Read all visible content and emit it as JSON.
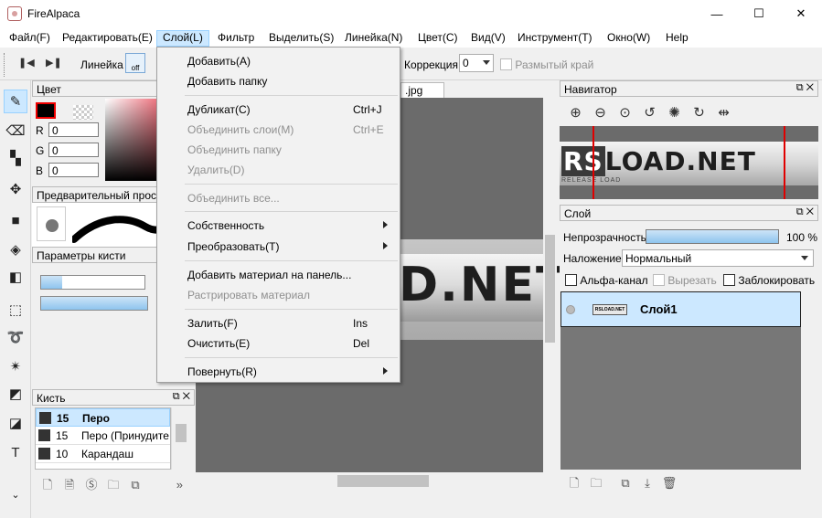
{
  "titlebar": {
    "title": "FireAlpaca",
    "minimize": "—",
    "maximize": "☐",
    "close": "✕"
  },
  "menubar": {
    "items": [
      "Файл(F)",
      "Редактировать(E)",
      "Слой(L)",
      "Фильтр",
      "Выделить(S)",
      "Линейка(N)",
      "Цвет(C)",
      "Вид(V)",
      "Инструмент(T)",
      "Окно(W)",
      "Help"
    ],
    "active": "Слой(L)"
  },
  "toolbar": {
    "ruler_label": "Линейка",
    "toggle_label": "off",
    "correction_label": "Коррекция",
    "correction_value": "0",
    "blur_edge_label": "Размытый край"
  },
  "dropdown": {
    "items": [
      {
        "label": "Добавить(A)",
        "enabled": true
      },
      {
        "label": "Добавить папку",
        "enabled": true
      },
      {
        "label": "Дубликат(C)",
        "shortcut": "Ctrl+J",
        "enabled": true
      },
      {
        "label": "Объединить слои(M)",
        "shortcut": "Ctrl+E",
        "enabled": false
      },
      {
        "label": "Объединить папку",
        "enabled": false
      },
      {
        "label": "Удалить(D)",
        "enabled": false
      },
      {
        "label": "Объединить все...",
        "enabled": false
      },
      {
        "label": "Собственность",
        "submenu": true,
        "enabled": true
      },
      {
        "label": "Преобразовать(T)",
        "submenu": true,
        "enabled": true
      },
      {
        "label": "Добавить материал на панель...",
        "enabled": true
      },
      {
        "label": "Растрировать материал",
        "enabled": false
      },
      {
        "label": "Залить(F)",
        "shortcut": "Ins",
        "enabled": true
      },
      {
        "label": "Очистить(E)",
        "shortcut": "Del",
        "enabled": true
      },
      {
        "label": "Повернуть(R)",
        "submenu": true,
        "enabled": true
      }
    ]
  },
  "color_panel": {
    "title": "Цвет",
    "r_label": "R",
    "g_label": "G",
    "b_label": "B",
    "r": "0",
    "g": "0",
    "b": "0",
    "fg_color": "#000000"
  },
  "preview_panel": {
    "title": "Предварительный прос..."
  },
  "brush_params": {
    "title": "Параметры кисти",
    "size_level": 0.2,
    "opacity_level": 1.0
  },
  "brush_panel": {
    "title": "Кисть",
    "items": [
      {
        "size": "15",
        "name": "Перо",
        "selected": true
      },
      {
        "size": "15",
        "name": "Перо (Принудите"
      },
      {
        "size": "10",
        "name": "Карандаш"
      }
    ]
  },
  "canvas": {
    "tab": ".jpg",
    "logo_text": "D.NET"
  },
  "navigator": {
    "title": "Навигатор",
    "logo_rs": "RS",
    "logo_rest": "LOAD.NET",
    "logo_sub": "RELEASE LOAD"
  },
  "layer_panel": {
    "title": "Слой",
    "opacity_label": "Непрозрачность",
    "opacity_value": "100 %",
    "blend_label": "Наложение",
    "blend_value": "Нормальный",
    "alpha_label": "Альфа-канал",
    "clip_label": "Вырезать",
    "lock_label": "Заблокировать",
    "layers": [
      {
        "name": "Слой1",
        "thumb": "RSLOAD.NET"
      }
    ]
  },
  "colors": {
    "accent": "#cce8ff",
    "selection_border": "#99d1ff",
    "fg_border": "#ee0000",
    "nav_frame": "#e00000"
  }
}
